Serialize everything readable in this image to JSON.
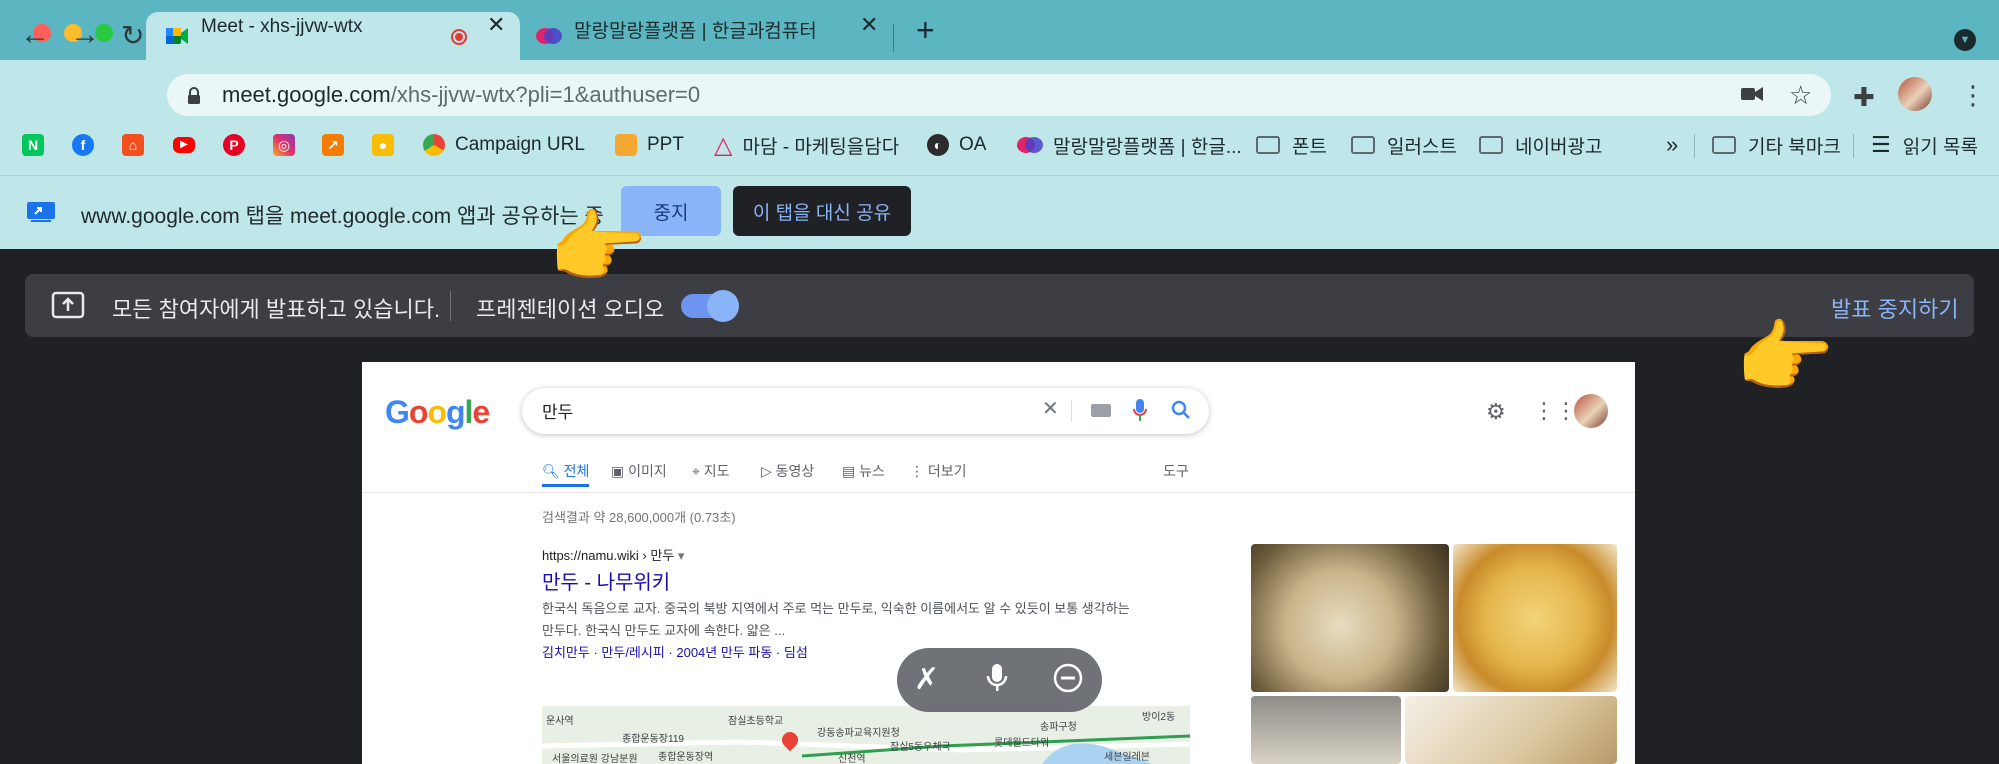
{
  "window": {
    "traffic_lights": [
      "#ff5f57",
      "#febc2e",
      "#28c840"
    ]
  },
  "tabs": [
    {
      "title": "Meet - xhs-jjvw-wtx",
      "icon": "google-meet-icon",
      "active": true,
      "recording": true
    },
    {
      "title": "말랑말랑플랫폼 | 한글과컴퓨터",
      "icon": "malang-icon",
      "active": false
    }
  ],
  "toolbar": {
    "url_host": "meet.google.com",
    "url_path": "/xhs-jjvw-wtx?pli=1&authuser=0",
    "icons": [
      "back-icon",
      "forward-icon",
      "reload-icon",
      "lock-icon",
      "camera-icon",
      "star-icon",
      "extensions-icon",
      "avatar",
      "menu-icon"
    ]
  },
  "bookmarks": {
    "items": [
      {
        "label": "",
        "icon": "naver-icon"
      },
      {
        "label": "",
        "icon": "facebook-icon"
      },
      {
        "label": "",
        "icon": "figma-icon"
      },
      {
        "label": "",
        "icon": "youtube-icon"
      },
      {
        "label": "",
        "icon": "pinterest-icon"
      },
      {
        "label": "",
        "icon": "instagram-icon"
      },
      {
        "label": "",
        "icon": "analytics-icon"
      },
      {
        "label": "",
        "icon": "keep-icon"
      },
      {
        "label": "Campaign URL",
        "icon": "chrome-icon"
      },
      {
        "label": "PPT",
        "icon": "ppt-icon"
      },
      {
        "label": "마담 - 마케팅을담다",
        "icon": "triangle-icon"
      },
      {
        "label": "OA",
        "icon": "globe-icon"
      },
      {
        "label": "말랑말랑플랫폼 | 한글...",
        "icon": "malang-icon"
      },
      {
        "label": "폰트",
        "icon": "folder-icon"
      },
      {
        "label": "일러스트",
        "icon": "folder-icon"
      },
      {
        "label": "네이버광고",
        "icon": "folder-icon"
      }
    ],
    "overflow": "»",
    "other_bookmarks": "기타 북마크",
    "reading_list": "읽기 목록"
  },
  "share_bar": {
    "text": "www.google.com 탭을 meet.google.com 앱과 공유하는 중",
    "stop_label": "중지",
    "share_this_label": "이 탭을 대신 공유"
  },
  "presenting": {
    "text": "모든 참여자에게 발표하고 있습니다.",
    "audio_label": "프레젠테이션 오디오",
    "audio_on": true,
    "stop_label": "발표 중지하기"
  },
  "google_page": {
    "logo": "Google",
    "query": "만두",
    "tabs": [
      "전체",
      "이미지",
      "지도",
      "동영상",
      "뉴스",
      "더보기"
    ],
    "tools_label": "도구",
    "stats": "검색결과 약 28,600,000개 (0.73초)",
    "cite": "https://namu.wiki › 만두",
    "result_title": "만두 - 나무위키",
    "snippet_line1": "한국식 독음으로 교자. 중국의 북방 지역에서 주로 먹는 만두로, 익숙한 이름에서도 알 수 있듯이 보통 생각하는",
    "snippet_line2": "만두다. 한국식 만두도 교자에 속한다. 얇은 ...",
    "links": "김치만두 · 만두/레시피 · 2004년 만두 파동 · 딤섬",
    "map_labels": [
      "잠실초등학교",
      "강동송파교육지원청",
      "종합운동장119",
      "잠실5동우체국",
      "롯데월드타워",
      "서울의료원 강남분원",
      "종합운동장역",
      "신천역",
      "송파구청",
      "세븐일레븐",
      "방이2동",
      "운사역"
    ]
  },
  "meet_controls": [
    "pin-off-icon",
    "mic-icon",
    "minus-circle-icon"
  ],
  "accent": {
    "meet_blue": "#8ab4f8",
    "tab_strip": "#5cb6c1",
    "toolbar": "#bfe6e9",
    "dark": "#202124"
  }
}
